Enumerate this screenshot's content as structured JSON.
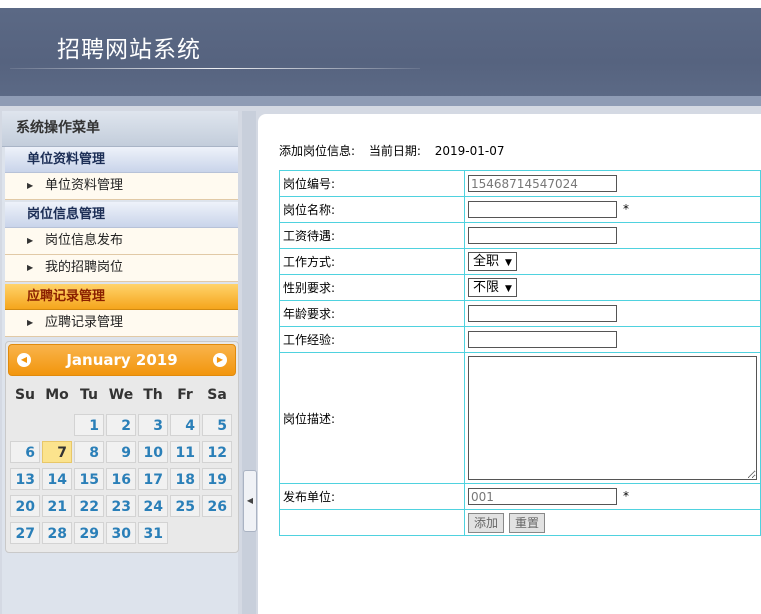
{
  "header": {
    "title": "招聘网站系统"
  },
  "sidebar": {
    "title": "系统操作菜单",
    "groups": [
      {
        "label": "单位资料管理",
        "items": [
          "单位资料管理"
        ]
      },
      {
        "label": "岗位信息管理",
        "items": [
          "岗位信息发布",
          "我的招聘岗位"
        ]
      },
      {
        "label": "应聘记录管理",
        "items": [
          "应聘记录管理"
        ]
      }
    ]
  },
  "calendar": {
    "month": "January 2019",
    "prev_icon": "◀",
    "next_icon": "▶",
    "weekdays": [
      "Su",
      "Mo",
      "Tu",
      "We",
      "Th",
      "Fr",
      "Sa"
    ],
    "today": 7
  },
  "splitter": {
    "icon": "◀"
  },
  "form": {
    "info_label": "添加岗位信息:",
    "date_label": "当前日期:",
    "date_value": "2019-01-07",
    "fields": {
      "code_label": "岗位编号:",
      "code_value": "15468714547024",
      "name_label": "岗位名称:",
      "salary_label": "工资待遇:",
      "mode_label": "工作方式:",
      "mode_value": "全职",
      "gender_label": "性别要求:",
      "gender_value": "不限",
      "age_label": "年龄要求:",
      "exp_label": "工作经验:",
      "desc_label": "岗位描述:",
      "publisher_label": "发布单位:",
      "publisher_value": "001",
      "required_mark": "*"
    },
    "buttons": {
      "add": "添加",
      "reset": "重置"
    }
  }
}
